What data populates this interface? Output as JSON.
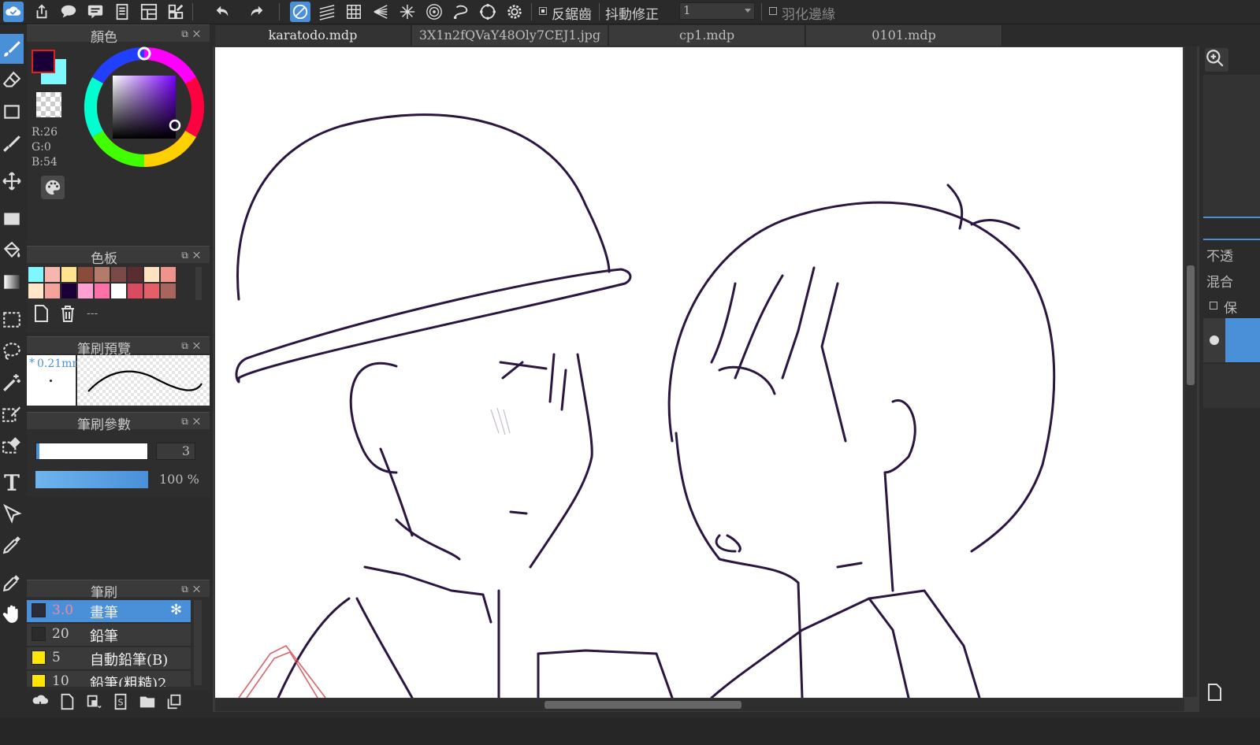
{
  "toolbar": {
    "antialias_label": "反鋸齒",
    "stabilizer_label": "抖動修正",
    "stabilizer_value": "1",
    "feather_label": "羽化邊緣"
  },
  "tabs": [
    {
      "label": "karatodo.mdp"
    },
    {
      "label": "3X1n2fQVaY48Oly7CEJ1.jpg"
    },
    {
      "label": "cp1.mdp"
    },
    {
      "label": "0101.mdp"
    }
  ],
  "color_panel": {
    "title": "顏色",
    "r": "R:26",
    "g": "G:0",
    "b": "B:54",
    "fg_color": "#1a0036",
    "bg_color": "#7ff7ff"
  },
  "palette_panel": {
    "title": "色板",
    "swatches_row1": [
      "#7ff7ff",
      "#f6b6ad",
      "#ffe38f",
      "#8a4b3a",
      "#b47a6a",
      "#7a4a46",
      "#5a2e30",
      "#ffe2c0",
      "#f0938a"
    ],
    "swatches_row2": [
      "#ffe6c6",
      "#f3a29c",
      "#1a0036",
      "#ff9fd2",
      "#ff6fa8",
      "#ffffff",
      "#d94b60",
      "#e45f68",
      "#a7655d"
    ],
    "more_label": "---"
  },
  "brush_preview_panel": {
    "title": "筆刷預覽",
    "size_label": "0.21mm"
  },
  "brush_param_panel": {
    "title": "筆刷參數",
    "size_value": "3",
    "opacity_value": "100 %",
    "size_fraction": 0.02,
    "opacity_fraction": 1.0
  },
  "brush_panel": {
    "title": "筆刷",
    "items": [
      {
        "size": "3.0",
        "name": "畫筆",
        "color": "#2b2b3a",
        "selected": true
      },
      {
        "size": "20",
        "name": "鉛筆",
        "color": "#2b2b2b",
        "selected": false
      },
      {
        "size": "5",
        "name": "自動鉛筆(B)",
        "color": "#ffe600",
        "selected": false
      },
      {
        "size": "10",
        "name": "鉛筆(粗糙)2",
        "color": "#ffe600",
        "selected": false
      }
    ]
  },
  "right_panel": {
    "opacity_label": "不透",
    "blend_label": "混合",
    "protect_label": "保"
  },
  "colors": {
    "accent": "#4a90d9",
    "ink": "#2a1640",
    "sketch_red": "#d9484f"
  }
}
